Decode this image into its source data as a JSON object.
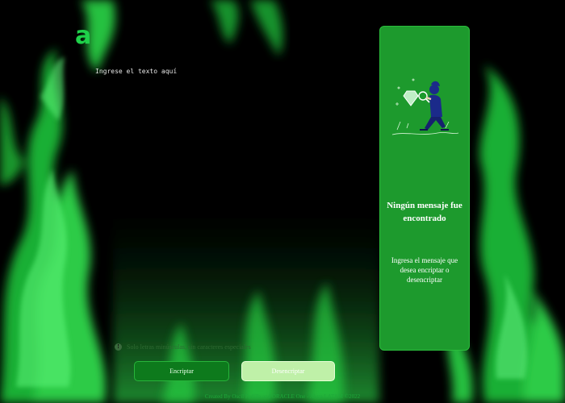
{
  "app": {
    "logo_text": "a"
  },
  "editor": {
    "placeholder": "Ingrese el texto aquí"
  },
  "hint": {
    "icon": "info-icon",
    "text": "Solo letras minúsculas, sin caracteres especiales"
  },
  "buttons": {
    "encrypt_label": "Encriptar",
    "decrypt_label": "Desencriptar"
  },
  "result_panel": {
    "title": "Ningún mensaje fue encontrado",
    "message": "Ingresa el mensaje que desea encriptar o desencriptar",
    "illustration": "person-with-magnifier-illustration"
  },
  "footer": {
    "text": "Created By Oscil Padilla and ORACLE One - Alura LATAM ©2022"
  },
  "colors": {
    "background": "#000000",
    "accent_green": "#1d9a2d",
    "encrypt_button": "#0d7a1c",
    "decrypt_button": "#bff0a8"
  }
}
